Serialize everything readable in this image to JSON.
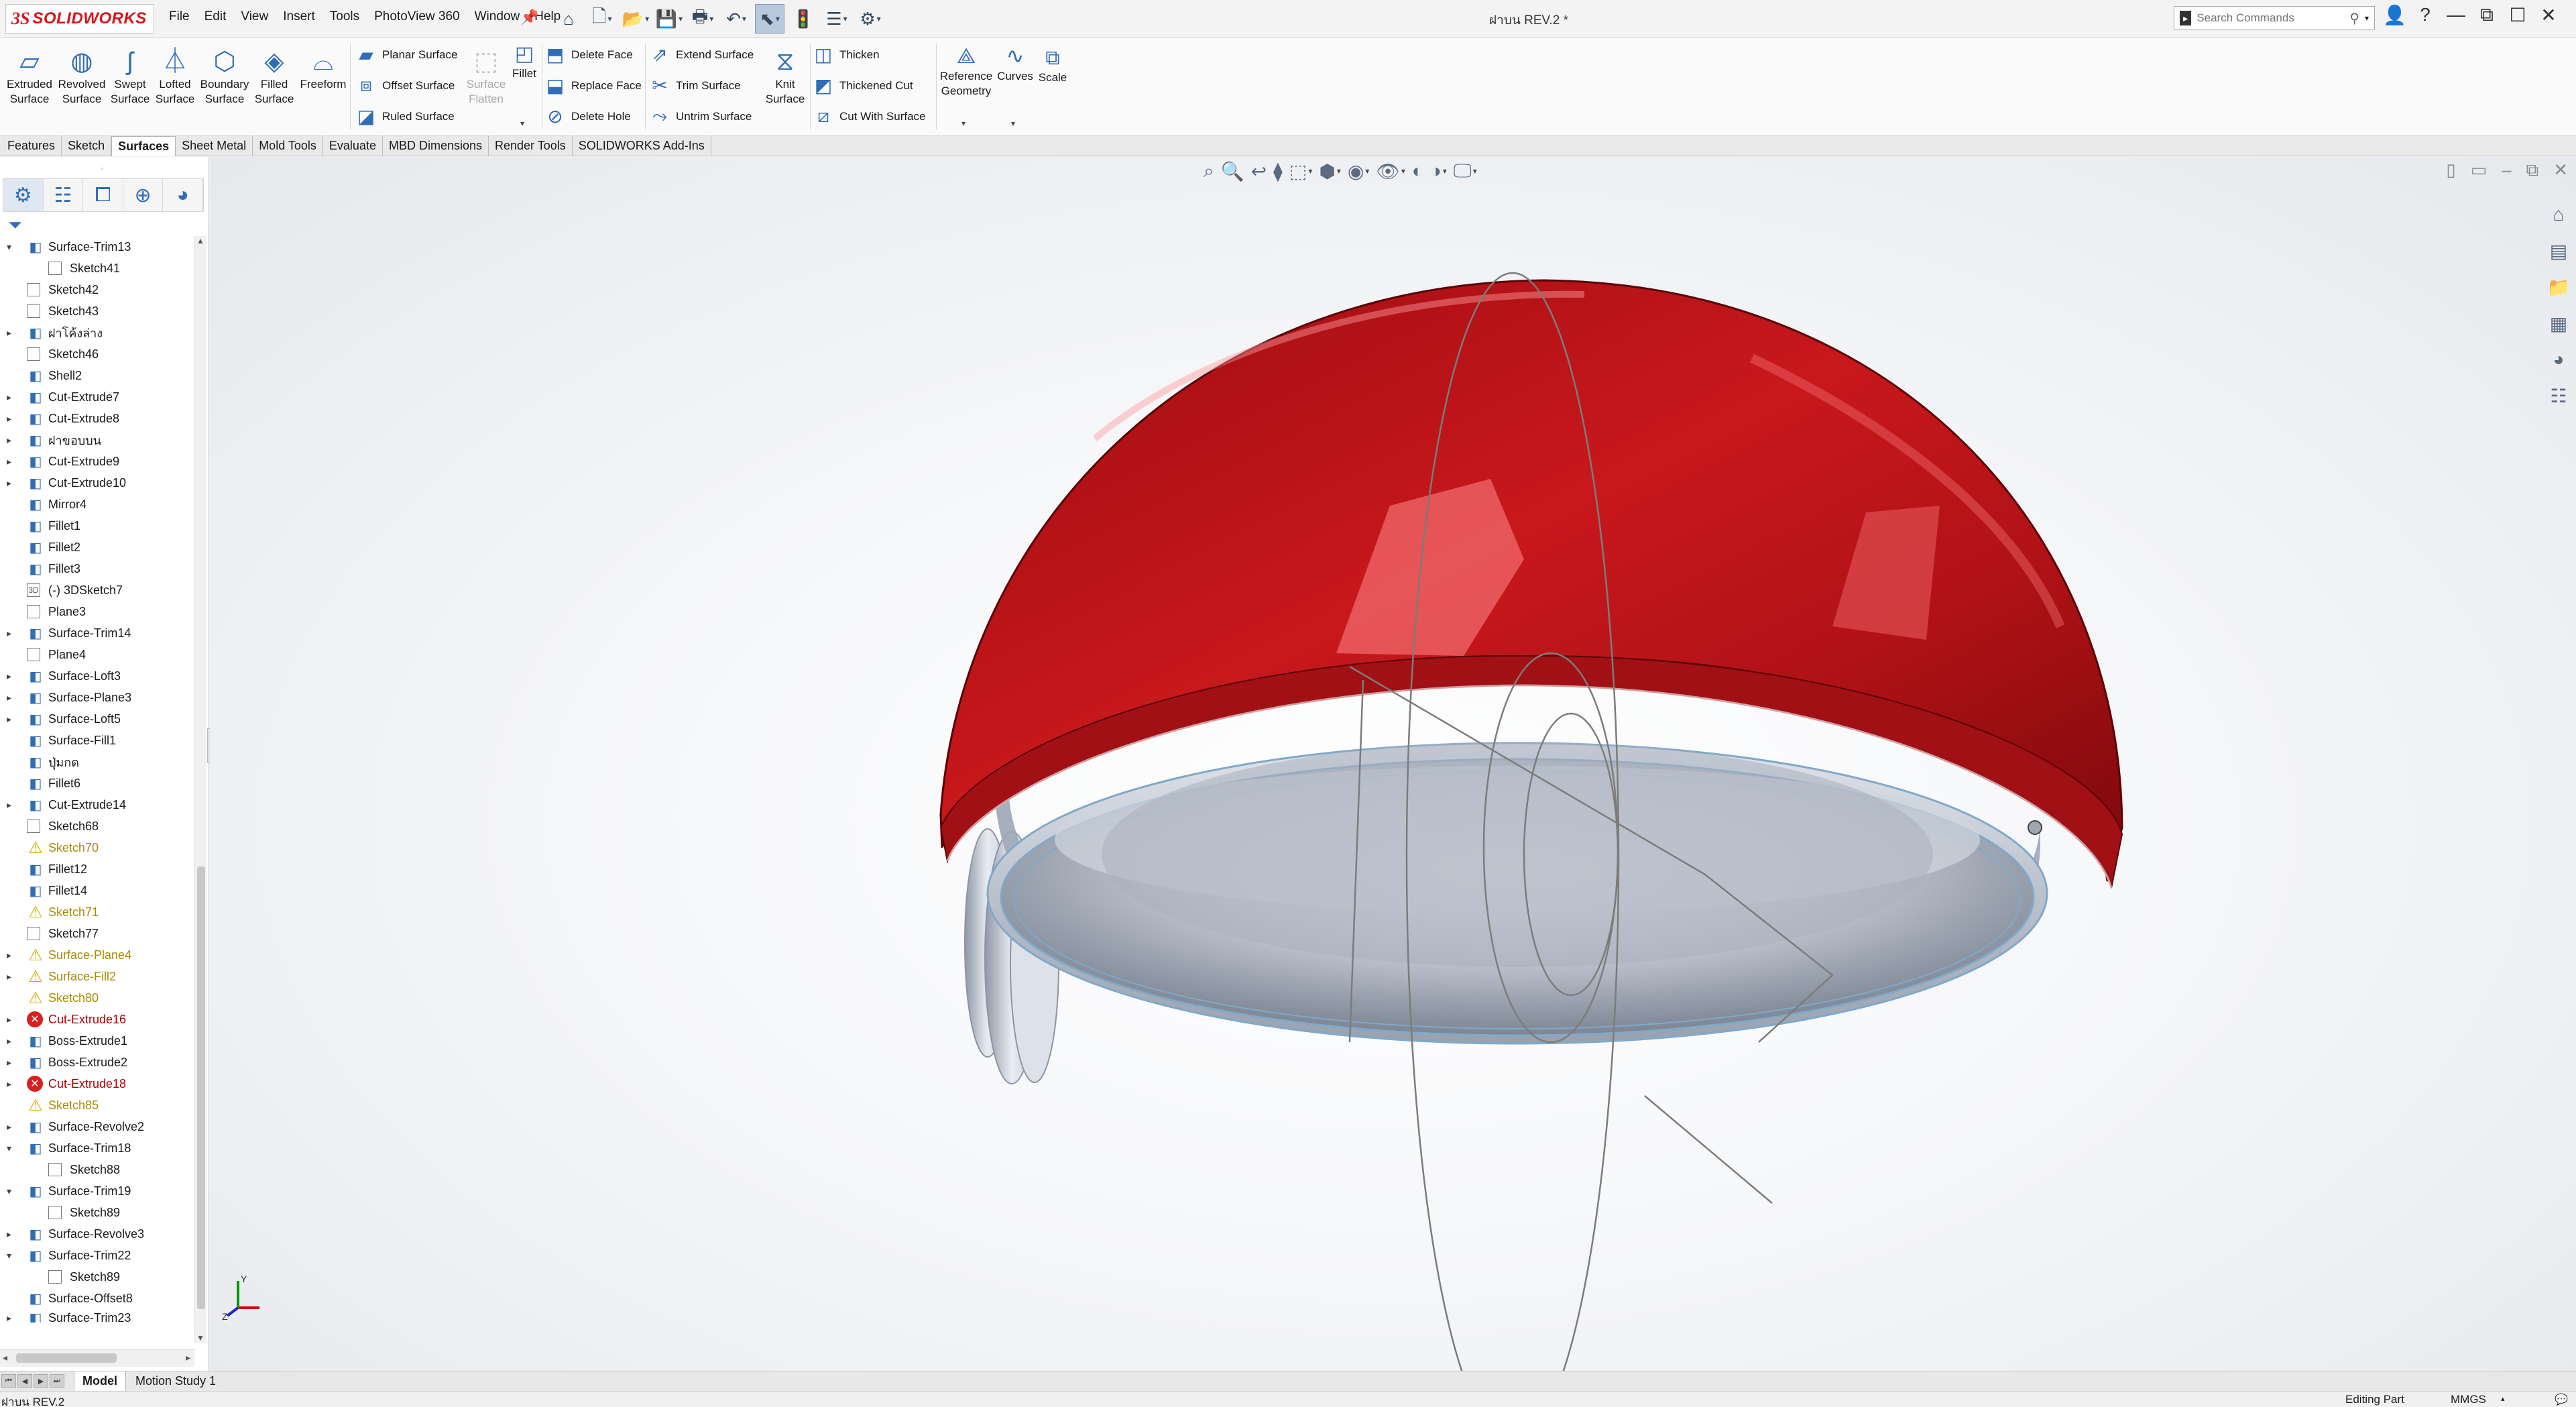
{
  "app": {
    "logo_ds": "3S",
    "logo_name": "SOLIDWORKS",
    "document_title": "ฝาบน REV.2 *",
    "menu": [
      "File",
      "Edit",
      "View",
      "Insert",
      "Tools",
      "PhotoView 360",
      "Window",
      "Help"
    ],
    "search_placeholder": "Search Commands",
    "accent_color": "#2f6db8",
    "brand_color": "#d7141a"
  },
  "ribbon": {
    "large_buttons": [
      {
        "label": "Extruded\nSurface",
        "icon": "extruded-surface-icon"
      },
      {
        "label": "Revolved\nSurface",
        "icon": "revolved-surface-icon"
      },
      {
        "label": "Swept\nSurface",
        "icon": "swept-surface-icon"
      },
      {
        "label": "Lofted\nSurface",
        "icon": "lofted-surface-icon"
      },
      {
        "label": "Boundary\nSurface",
        "icon": "boundary-surface-icon"
      },
      {
        "label": "Filled\nSurface",
        "icon": "filled-surface-icon"
      },
      {
        "label": "Freeform",
        "icon": "freeform-icon"
      }
    ],
    "col1": [
      "Planar Surface",
      "Offset Surface",
      "Ruled Surface"
    ],
    "surface_flatten": "Surface\nFlatten",
    "fillet": "Fillet",
    "col2": [
      "Delete Face",
      "Replace Face",
      "Delete Hole"
    ],
    "col3": [
      "Extend Surface",
      "Trim Surface",
      "Untrim Surface"
    ],
    "knit_surface": "Knit\nSurface",
    "col4": [
      "Thicken",
      "Thickened Cut",
      "Cut With Surface"
    ],
    "reference_geometry": "Reference\nGeometry",
    "curves": "Curves",
    "scale": "Scale"
  },
  "command_tabs": [
    "Features",
    "Sketch",
    "Surfaces",
    "Sheet Metal",
    "Mold Tools",
    "Evaluate",
    "MBD Dimensions",
    "Render Tools",
    "SOLIDWORKS Add-Ins"
  ],
  "active_command_tab": "Surfaces",
  "tree": [
    {
      "label": "Surface-Trim13",
      "type": "feat",
      "exp": "down",
      "indent": 0
    },
    {
      "label": "Sketch41",
      "type": "sketch",
      "exp": "",
      "indent": 1
    },
    {
      "label": "Sketch42",
      "type": "sketch",
      "exp": "",
      "indent": 0
    },
    {
      "label": "Sketch43",
      "type": "sketch",
      "exp": "",
      "indent": 0
    },
    {
      "label": "ฝาโค้งล่าง",
      "type": "feat",
      "exp": "right",
      "indent": 0
    },
    {
      "label": "Sketch46",
      "type": "sketch",
      "exp": "",
      "indent": 0
    },
    {
      "label": "Shell2",
      "type": "feat",
      "exp": "",
      "indent": 0
    },
    {
      "label": "Cut-Extrude7",
      "type": "feat",
      "exp": "right",
      "indent": 0
    },
    {
      "label": "Cut-Extrude8",
      "type": "feat",
      "exp": "right",
      "indent": 0
    },
    {
      "label": "ฝาขอบบน",
      "type": "feat",
      "exp": "right",
      "indent": 0
    },
    {
      "label": "Cut-Extrude9",
      "type": "feat",
      "exp": "right",
      "indent": 0
    },
    {
      "label": "Cut-Extrude10",
      "type": "feat",
      "exp": "right",
      "indent": 0
    },
    {
      "label": "Mirror4",
      "type": "feat",
      "exp": "",
      "indent": 0
    },
    {
      "label": "Fillet1",
      "type": "feat",
      "exp": "",
      "indent": 0
    },
    {
      "label": "Fillet2",
      "type": "feat",
      "exp": "",
      "indent": 0
    },
    {
      "label": "Fillet3",
      "type": "feat",
      "exp": "",
      "indent": 0
    },
    {
      "label": "(-) 3DSketch7",
      "type": "sketch3d",
      "exp": "",
      "indent": 0
    },
    {
      "label": "Plane3",
      "type": "plane",
      "exp": "",
      "indent": 0
    },
    {
      "label": "Surface-Trim14",
      "type": "feat",
      "exp": "right",
      "indent": 0
    },
    {
      "label": "Plane4",
      "type": "plane",
      "exp": "",
      "indent": 0
    },
    {
      "label": "Surface-Loft3",
      "type": "feat",
      "exp": "right",
      "indent": 0
    },
    {
      "label": "Surface-Plane3",
      "type": "feat",
      "exp": "right",
      "indent": 0
    },
    {
      "label": "Surface-Loft5",
      "type": "feat",
      "exp": "right",
      "indent": 0
    },
    {
      "label": "Surface-Fill1",
      "type": "feat",
      "exp": "",
      "indent": 0
    },
    {
      "label": "ปุ่มกด",
      "type": "feat",
      "exp": "",
      "indent": 0
    },
    {
      "label": "Fillet6",
      "type": "feat",
      "exp": "",
      "indent": 0
    },
    {
      "label": "Cut-Extrude14",
      "type": "feat",
      "exp": "right",
      "indent": 0
    },
    {
      "label": "Sketch68",
      "type": "sketch",
      "exp": "",
      "indent": 0
    },
    {
      "label": "Sketch70",
      "type": "warn",
      "exp": "",
      "indent": 0
    },
    {
      "label": "Fillet12",
      "type": "feat",
      "exp": "",
      "indent": 0
    },
    {
      "label": "Fillet14",
      "type": "feat",
      "exp": "",
      "indent": 0
    },
    {
      "label": "Sketch71",
      "type": "warn",
      "exp": "",
      "indent": 0
    },
    {
      "label": "Sketch77",
      "type": "sketch",
      "exp": "",
      "indent": 0
    },
    {
      "label": "Surface-Plane4",
      "type": "warn",
      "exp": "right",
      "indent": 0
    },
    {
      "label": "Surface-Fill2",
      "type": "warn",
      "exp": "right",
      "indent": 0
    },
    {
      "label": "Sketch80",
      "type": "warn",
      "exp": "",
      "indent": 0
    },
    {
      "label": "Cut-Extrude16",
      "type": "err",
      "exp": "right",
      "indent": 0
    },
    {
      "label": "Boss-Extrude1",
      "type": "feat",
      "exp": "right",
      "indent": 0
    },
    {
      "label": "Boss-Extrude2",
      "type": "feat",
      "exp": "right",
      "indent": 0
    },
    {
      "label": "Cut-Extrude18",
      "type": "err",
      "exp": "right",
      "indent": 0
    },
    {
      "label": "Sketch85",
      "type": "warn",
      "exp": "",
      "indent": 0
    },
    {
      "label": "Surface-Revolve2",
      "type": "feat",
      "exp": "right",
      "indent": 0
    },
    {
      "label": "Surface-Trim18",
      "type": "feat",
      "exp": "down",
      "indent": 0
    },
    {
      "label": "Sketch88",
      "type": "sketch",
      "exp": "",
      "indent": 1
    },
    {
      "label": "Surface-Trim19",
      "type": "feat",
      "exp": "down",
      "indent": 0
    },
    {
      "label": "Sketch89",
      "type": "sketch",
      "exp": "",
      "indent": 1
    },
    {
      "label": "Surface-Revolve3",
      "type": "feat",
      "exp": "right",
      "indent": 0
    },
    {
      "label": "Surface-Trim22",
      "type": "feat",
      "exp": "down",
      "indent": 0
    },
    {
      "label": "Sketch89",
      "type": "sketch",
      "exp": "",
      "indent": 1
    },
    {
      "label": "Surface-Offset8",
      "type": "feat",
      "exp": "",
      "indent": 0
    },
    {
      "label": "Surface-Trim23",
      "type": "feat",
      "exp": "right",
      "indent": 0
    }
  ],
  "bottom_tabs": [
    "Model",
    "Motion Study 1"
  ],
  "active_bottom_tab": "Model",
  "status": {
    "left": "ฝาบน REV.2",
    "editing": "Editing Part",
    "units": "MMGS"
  },
  "model_colors": {
    "shell_red": "#c0171a",
    "inner_gray": "#b9bfca",
    "edge_blue": "#7fa9c9"
  }
}
